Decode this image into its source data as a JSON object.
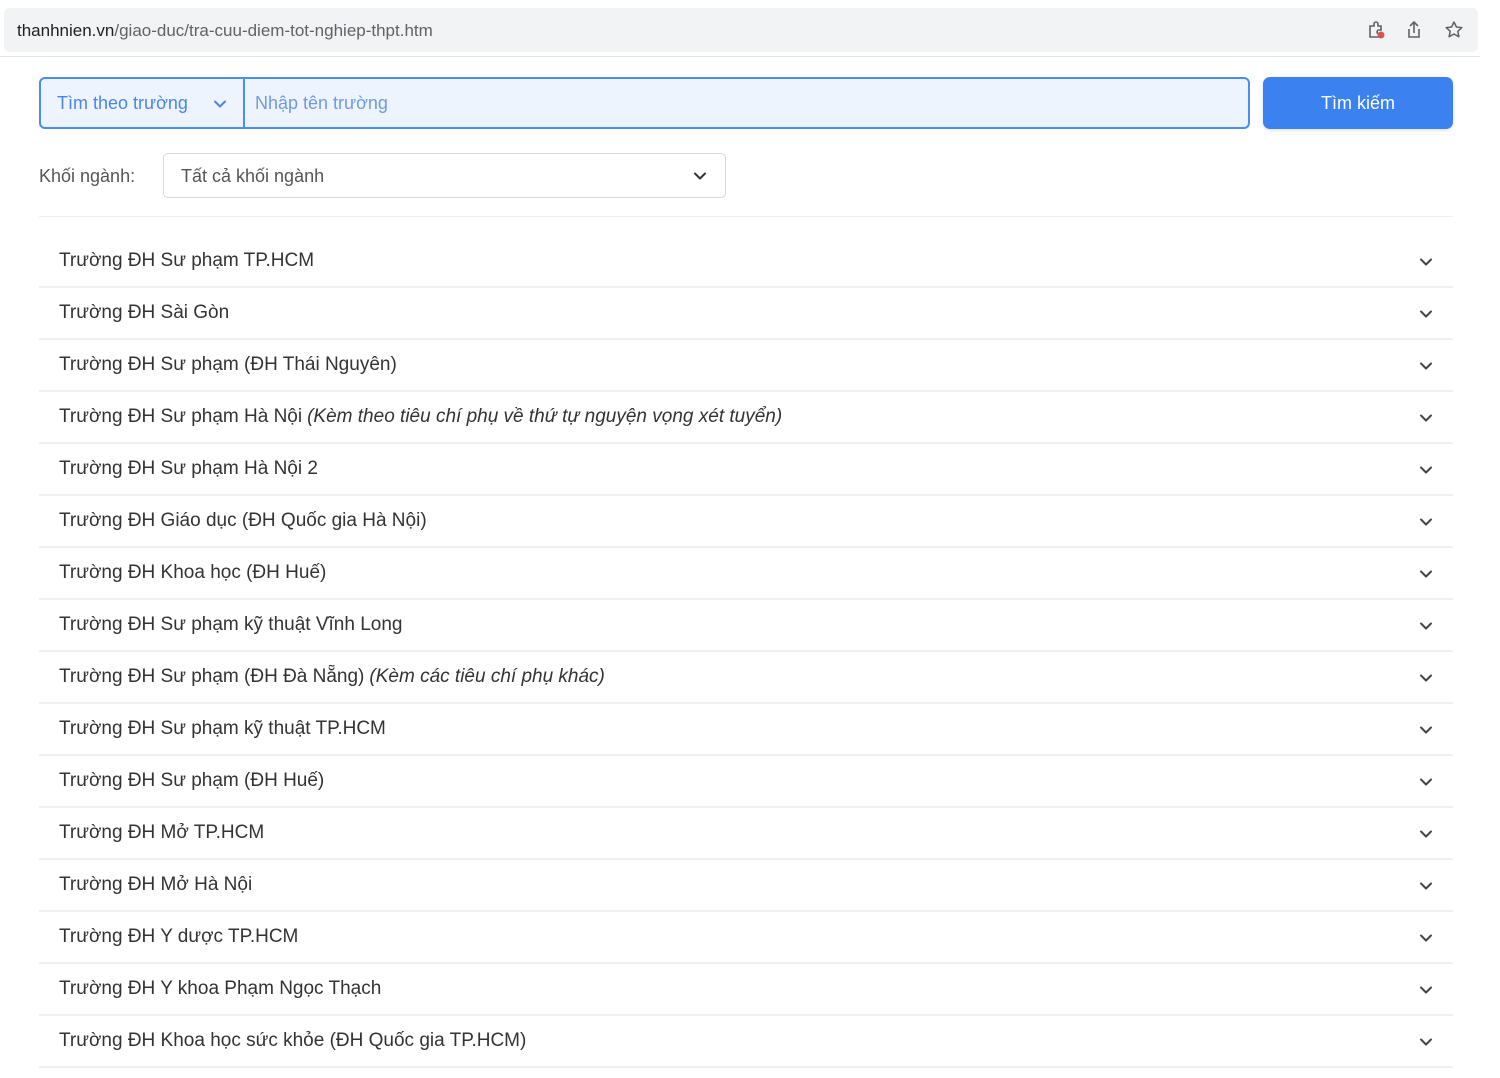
{
  "browser": {
    "url_host": "thanhnien.vn",
    "url_path": "/giao-duc/tra-cuu-diem-tot-nghiep-thpt.htm",
    "icons": [
      "extension-icon",
      "share-icon",
      "star-icon"
    ]
  },
  "search": {
    "mode_value": "Tìm theo trường",
    "placeholder": "Nhập tên trường",
    "button_label": "Tìm kiếm"
  },
  "filter": {
    "label": "Khối ngành:",
    "value": "Tất cả khối ngành"
  },
  "colors": {
    "accent": "#3b82f0",
    "input_bg": "#eef4fd",
    "input_border": "#4a8ef0"
  },
  "schools": [
    {
      "name": "Trường ĐH Sư phạm TP.HCM",
      "note": ""
    },
    {
      "name": "Trường ĐH Sài Gòn",
      "note": ""
    },
    {
      "name": "Trường ĐH Sư phạm (ĐH Thái Nguyên)",
      "note": ""
    },
    {
      "name": "Trường ĐH Sư phạm Hà Nội",
      "note": "(Kèm theo tiêu chí phụ về thứ tự nguyện vọng xét tuyển)"
    },
    {
      "name": "Trường ĐH Sư phạm Hà Nội 2",
      "note": ""
    },
    {
      "name": "Trường ĐH Giáo dục (ĐH Quốc gia Hà Nội)",
      "note": ""
    },
    {
      "name": "Trường ĐH Khoa học (ĐH Huế)",
      "note": ""
    },
    {
      "name": "Trường ĐH Sư phạm kỹ thuật Vĩnh Long",
      "note": ""
    },
    {
      "name": "Trường ĐH Sư phạm (ĐH Đà Nẵng)",
      "note": "(Kèm các tiêu chí phụ khác)"
    },
    {
      "name": "Trường ĐH Sư phạm kỹ thuật TP.HCM",
      "note": ""
    },
    {
      "name": "Trường ĐH Sư phạm (ĐH Huế)",
      "note": ""
    },
    {
      "name": "Trường ĐH Mở TP.HCM",
      "note": ""
    },
    {
      "name": "Trường ĐH Mở Hà Nội",
      "note": ""
    },
    {
      "name": "Trường ĐH Y dược TP.HCM",
      "note": ""
    },
    {
      "name": "Trường ĐH Y khoa Phạm Ngọc Thạch",
      "note": ""
    },
    {
      "name": "Trường ĐH Khoa học sức khỏe (ĐH Quốc gia TP.HCM)",
      "note": ""
    }
  ]
}
